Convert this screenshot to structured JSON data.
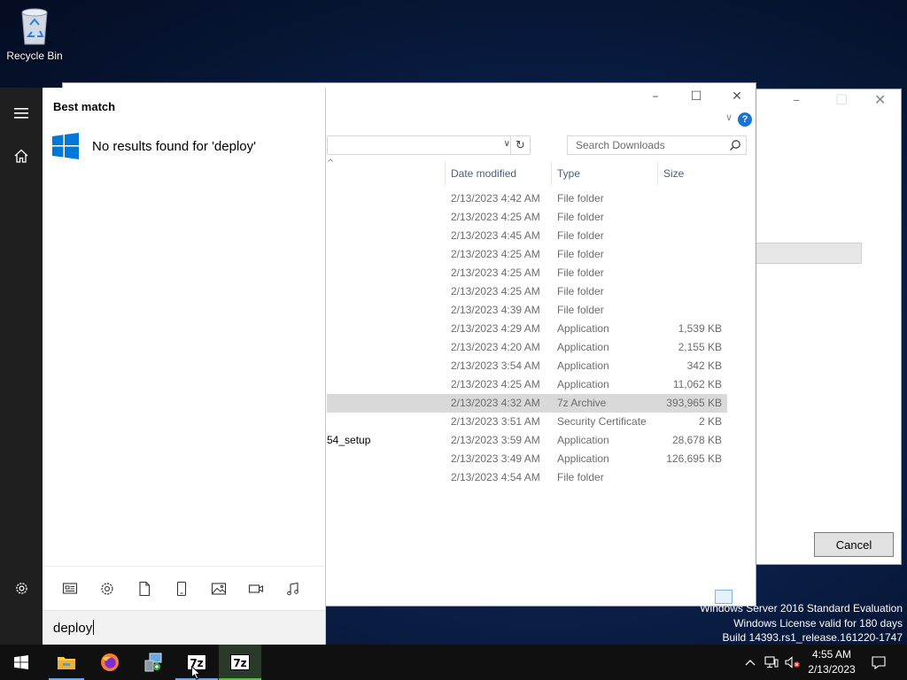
{
  "desktop": {
    "recycle_bin_label": "Recycle Bin"
  },
  "watermark": {
    "line1": "Windows Server 2016 Standard Evaluation",
    "line2": "Windows License valid for 180 days",
    "line3": "Build 14393.rs1_release.161220-1747"
  },
  "dialog": {
    "cancel_label": "Cancel"
  },
  "explorer": {
    "search_placeholder": "Search Downloads",
    "columns": {
      "date_modified": "Date modified",
      "type": "Type",
      "size": "Size"
    },
    "rows": [
      {
        "name": "",
        "date": "2/13/2023 4:42 AM",
        "type": "File folder",
        "size": ""
      },
      {
        "name": "",
        "date": "2/13/2023 4:25 AM",
        "type": "File folder",
        "size": ""
      },
      {
        "name": "",
        "date": "2/13/2023 4:45 AM",
        "type": "File folder",
        "size": ""
      },
      {
        "name": "",
        "date": "2/13/2023 4:25 AM",
        "type": "File folder",
        "size": ""
      },
      {
        "name": "",
        "date": "2/13/2023 4:25 AM",
        "type": "File folder",
        "size": ""
      },
      {
        "name": "",
        "date": "2/13/2023 4:25 AM",
        "type": "File folder",
        "size": ""
      },
      {
        "name": "",
        "date": "2/13/2023 4:39 AM",
        "type": "File folder",
        "size": ""
      },
      {
        "name": "",
        "date": "2/13/2023 4:29 AM",
        "type": "Application",
        "size": "1,539 KB"
      },
      {
        "name": "",
        "date": "2/13/2023 4:20 AM",
        "type": "Application",
        "size": "2,155 KB"
      },
      {
        "name": "",
        "date": "2/13/2023 3:54 AM",
        "type": "Application",
        "size": "342 KB"
      },
      {
        "name": "",
        "date": "2/13/2023 4:25 AM",
        "type": "Application",
        "size": "11,062 KB"
      },
      {
        "name": "",
        "date": "2/13/2023 4:32 AM",
        "type": "7z Archive",
        "size": "393,965 KB"
      },
      {
        "name": "",
        "date": "2/13/2023 3:51 AM",
        "type": "Security Certificate",
        "size": "2 KB"
      },
      {
        "name": "54_setup",
        "date": "2/13/2023 3:59 AM",
        "type": "Application",
        "size": "28,678 KB"
      },
      {
        "name": "",
        "date": "2/13/2023 3:49 AM",
        "type": "Application",
        "size": "126,695 KB"
      },
      {
        "name": "",
        "date": "2/13/2023 4:54 AM",
        "type": "File folder",
        "size": ""
      }
    ]
  },
  "start_menu": {
    "best_match_label": "Best match",
    "no_results_text": "No results found for 'deploy'",
    "query": "deploy"
  },
  "taskbar": {
    "seven_zip_label": "7z",
    "clock_time": "4:55 AM",
    "clock_date": "2/13/2023"
  },
  "colors": {
    "accent": "#0078d7",
    "taskbar": "#101010",
    "start_rail": "#1f1f1f"
  }
}
